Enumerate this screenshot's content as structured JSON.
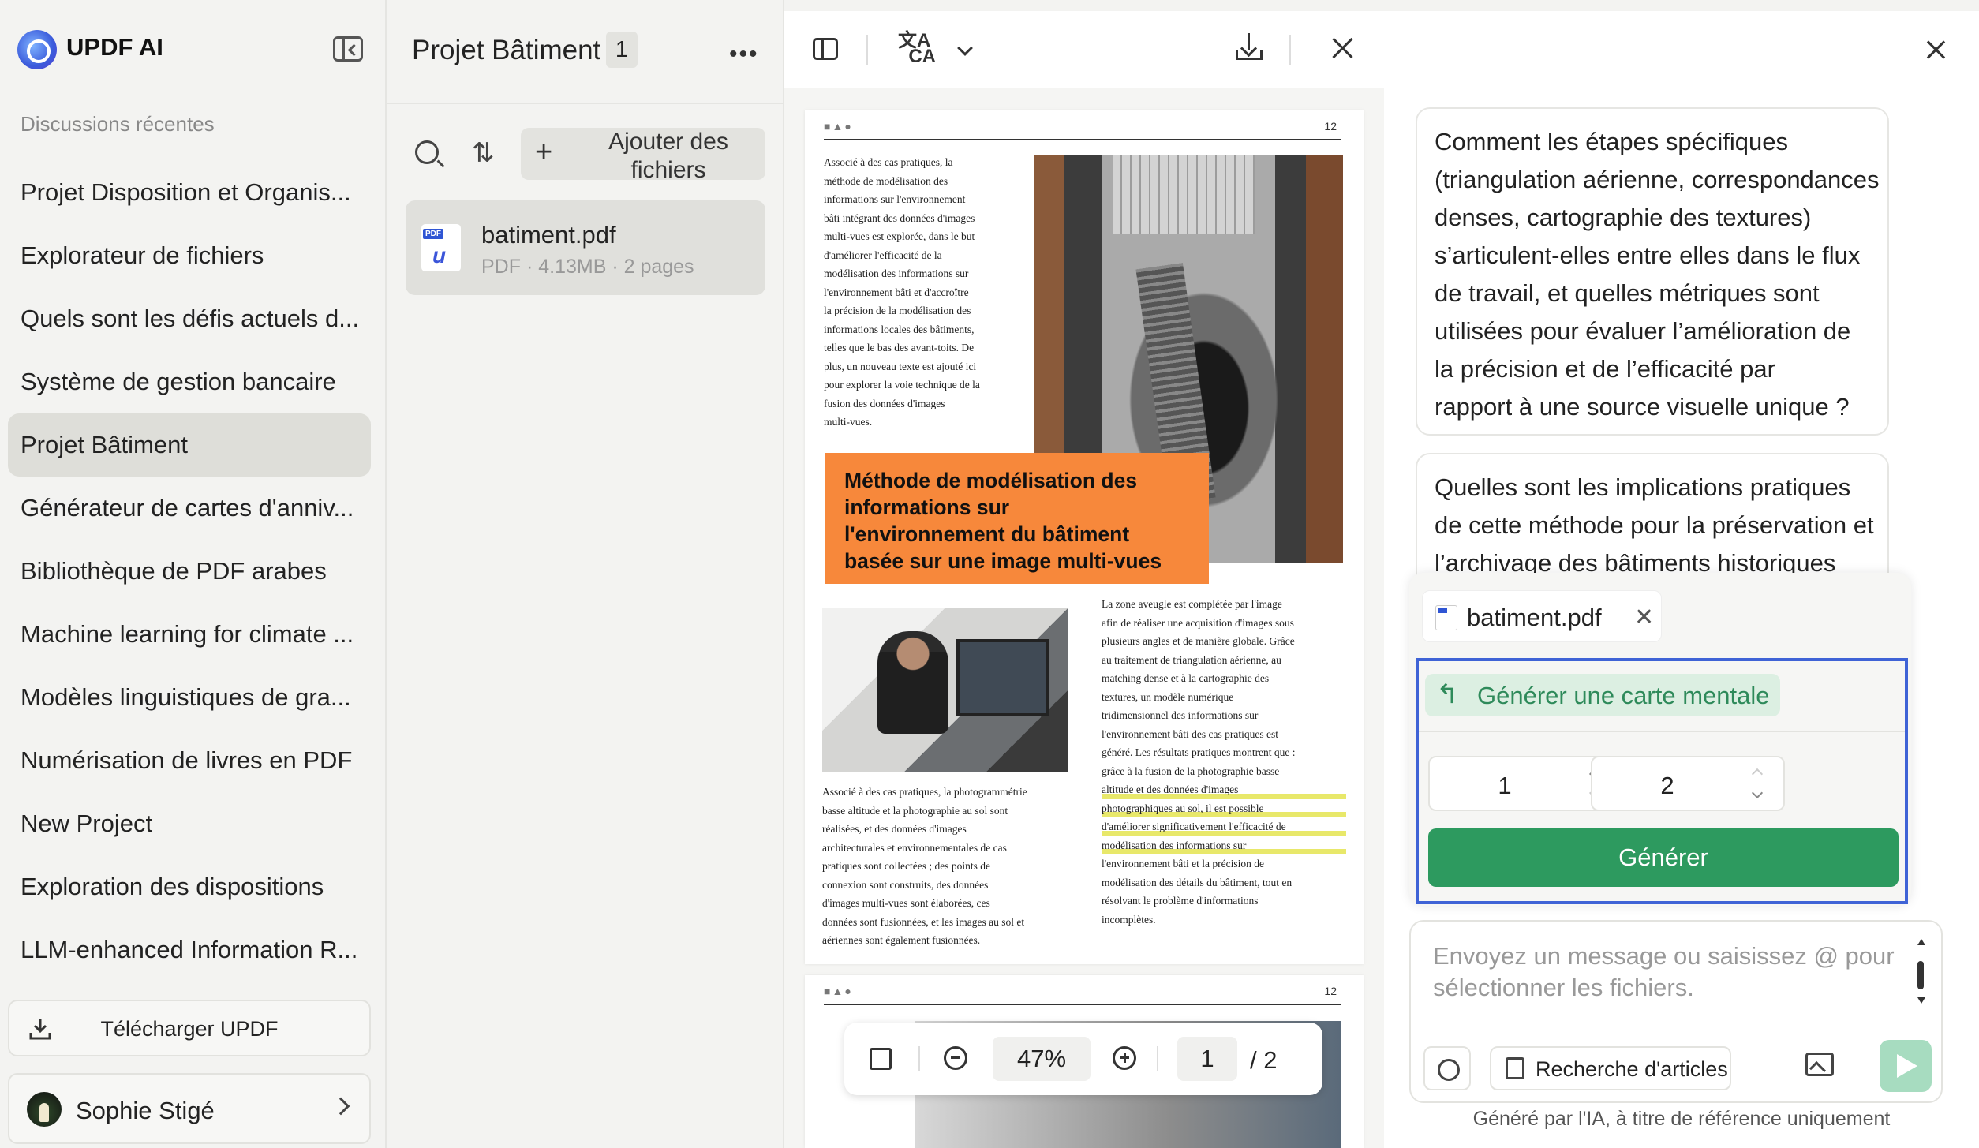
{
  "app": {
    "brand": "UPDF AI"
  },
  "sidebar": {
    "section_title": "Discussions récentes",
    "items": [
      {
        "label": "Projet Disposition et Organis..."
      },
      {
        "label": "Explorateur de fichiers"
      },
      {
        "label": "Quels sont les défis actuels d..."
      },
      {
        "label": "Système de gestion bancaire"
      },
      {
        "label": "Projet Bâtiment",
        "active": true
      },
      {
        "label": "Générateur de cartes d'anniv..."
      },
      {
        "label": "Bibliothèque de PDF arabes"
      },
      {
        "label": "Machine learning for climate ..."
      },
      {
        "label": "Modèles linguistiques de gra..."
      },
      {
        "label": "Numérisation de livres en PDF"
      },
      {
        "label": "New Project"
      },
      {
        "label": "Exploration des dispositions"
      },
      {
        "label": "LLM-enhanced Information R..."
      }
    ],
    "download_label": "Télécharger UPDF",
    "user_name": "Sophie Stigé"
  },
  "files": {
    "project_title": "Projet Bâtiment",
    "count": "1",
    "add_label": "Ajouter des fichiers",
    "file": {
      "name": "batiment.pdf",
      "meta": "PDF · 4.13MB · 2 pages"
    }
  },
  "viewer": {
    "page1": {
      "page_number": "12",
      "left_text": [
        "Associé à des cas pratiques, la",
        "méthode de modélisation des",
        "informations sur l'environnement",
        "bâti intégrant des données d'images",
        "multi-vues est explorée, dans le but",
        "d'améliorer l'efficacité de la",
        "modélisation des informations sur",
        "l'environnement bâti et d'accroître",
        "la précision de la modélisation des",
        "informations locales des bâtiments,",
        "telles que le bas des avant-toits. De",
        "plus, un nouveau texte est ajouté ici",
        "pour explorer la voie technique de la",
        "fusion des données d'images",
        "multi-vues."
      ],
      "title_lines": [
        "Méthode de modélisation des",
        "informations sur",
        "l'environnement du bâtiment",
        "basée sur une image multi-vues"
      ],
      "bottom_left_text": [
        "Associé à des cas pratiques, la photogrammétrie",
        "basse altitude et la photographie au sol sont",
        "réalisées, et des données d'images",
        "architecturales et environnementales de cas",
        "pratiques sont collectées ; des points de",
        "connexion sont construits, des données",
        "d'images multi-vues sont élaborées, ces",
        "données sont fusionnées, et les images au sol et",
        "aériennes sont également fusionnées."
      ],
      "right_text": [
        "La zone aveugle est complétée par l'image",
        "afin de réaliser une acquisition d'images sous",
        "plusieurs angles et de manière globale. Grâce",
        "au traitement de triangulation aérienne, au",
        "matching dense et à la cartographie des",
        "textures, un modèle numérique",
        "tridimensionnel des informations sur",
        "l'environnement bâti des cas pratiques est",
        "généré. Les résultats pratiques montrent que :",
        "grâce à la fusion de la photographie basse",
        "altitude et des données d'images",
        "photographiques au sol, il est possible",
        "d'améliorer significativement l'efficacité de",
        "modélisation des informations sur",
        "l'environnement bâti et la précision de",
        "modélisation des détails du bâtiment, tout en",
        "résolvant le problème d'informations",
        "incomplètes."
      ]
    },
    "page2": {
      "page_number": "12"
    },
    "zoom": "47%",
    "current_page": "1",
    "total_pages": "/ 2"
  },
  "chat": {
    "bubble1_lines": [
      "Comment les étapes spécifiques",
      "(triangulation aérienne, correspondances",
      "denses, cartographie des textures)",
      "s’articulent-elles entre elles dans le flux",
      "de travail, et quelles métriques sont",
      "utilisées pour évaluer l’amélioration de",
      "la précision et de l’efficacité par",
      "rapport à une source visuelle unique ?"
    ],
    "bubble2_lines": [
      "Quelles sont les implications pratiques",
      "de cette méthode pour la préservation et",
      "l’archivage des bâtiments historiques"
    ],
    "attached_file": "batiment.pdf",
    "mindmap_label": "Générer une carte mentale",
    "page_from": "1",
    "page_to": "2",
    "range_separator": "-",
    "generate_label": "Générer",
    "input_placeholder": "Envoyez un message ou saisissez @ pour sélectionner les fichiers.",
    "search_articles_label": "Recherche d'articles",
    "disclaimer": "Généré par l'IA, à titre de référence uniquement"
  },
  "colors": {
    "accent_green": "#2d9a5f",
    "title_orange": "#f7883b",
    "highlight_blue": "#3f63d6"
  }
}
